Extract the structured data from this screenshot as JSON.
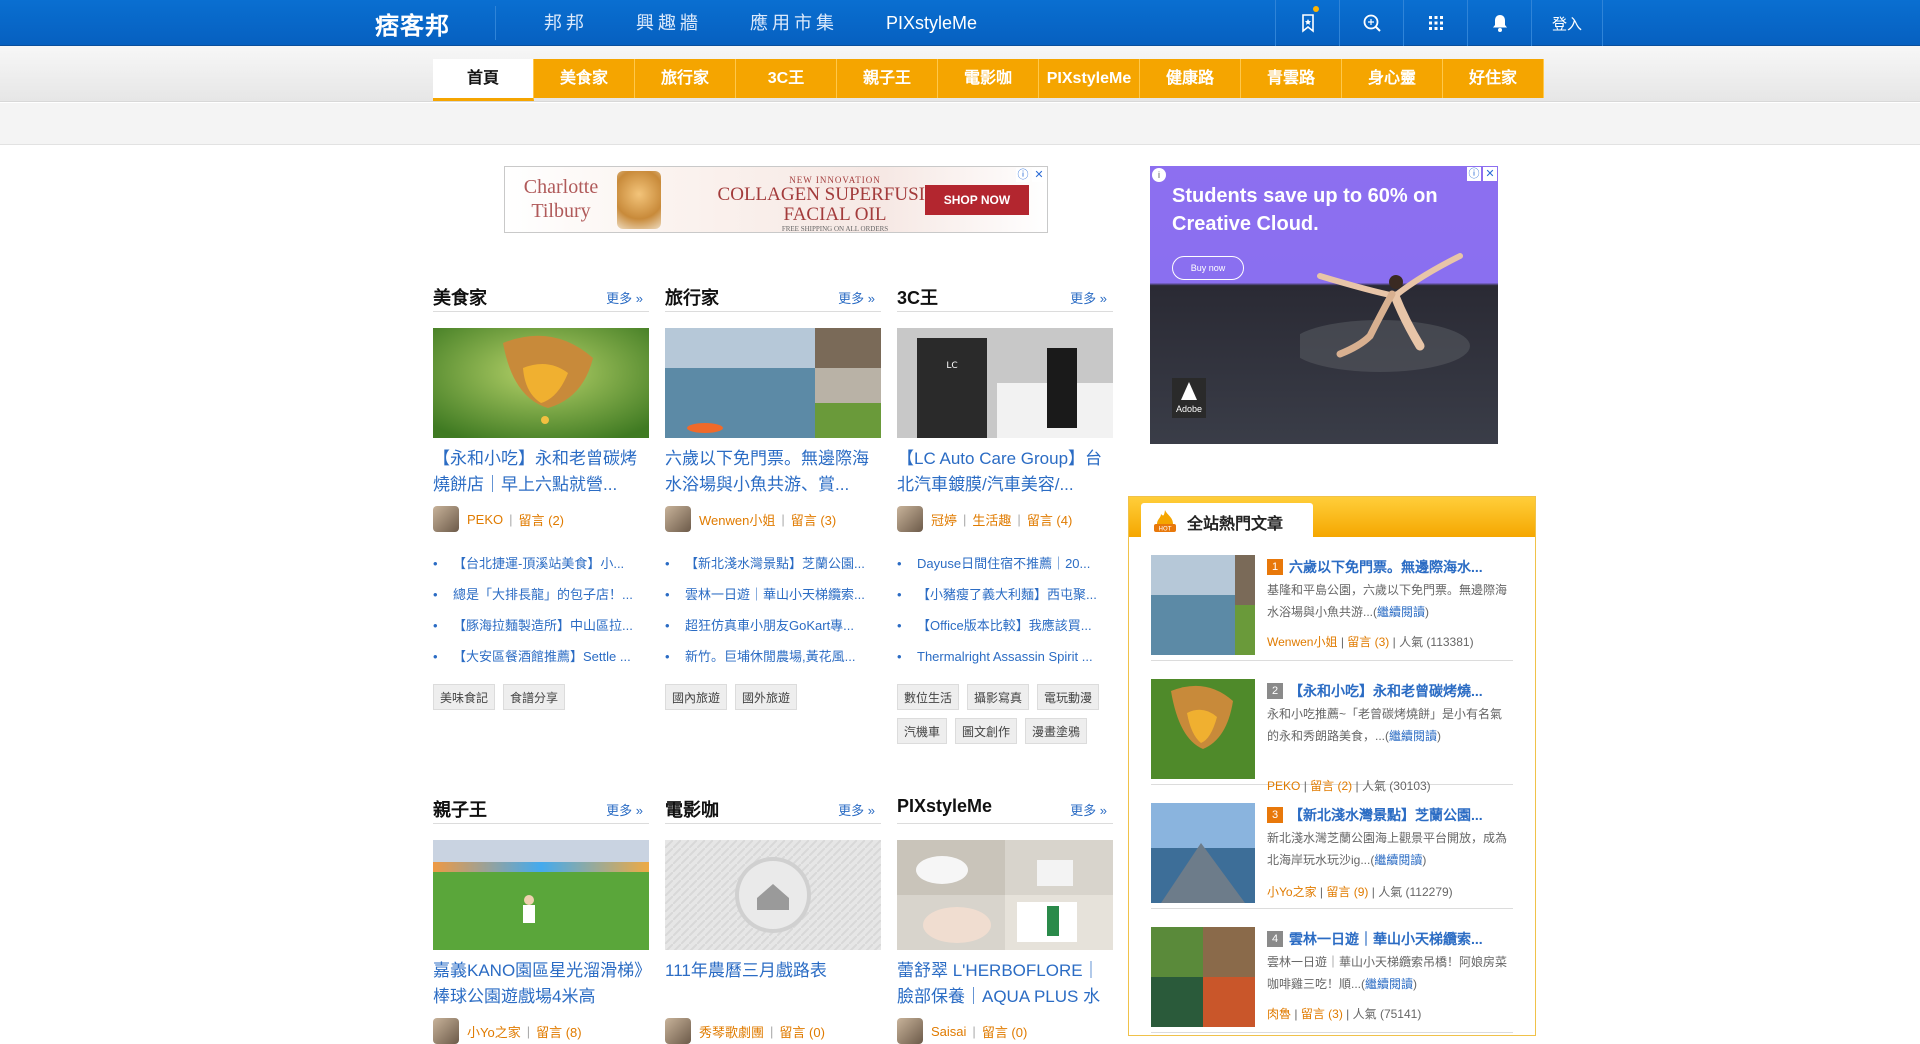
{
  "topbar": {
    "logo_text": "痞客邦",
    "nav": [
      "邦邦",
      "興趣牆",
      "應用市集",
      "PIXstyleMe"
    ],
    "login": "登入",
    "icons": [
      "bookmark-icon",
      "search-icon",
      "apps-grid-icon",
      "bell-icon"
    ]
  },
  "categories": {
    "tabs": [
      "首頁",
      "美食家",
      "旅行家",
      "3C王",
      "親子王",
      "電影咖",
      "PIXstyleMe",
      "健康路",
      "青雲路",
      "身心靈",
      "好住家"
    ],
    "active": "首頁",
    "active_color": "#f5a500"
  },
  "ads": {
    "top": {
      "brand": "Charlotte Tilbury",
      "line1": "NEW INNOVATION",
      "line2": "COLLAGEN SUPERFUSION",
      "line3": "FACIAL OIL",
      "line4": "FREE SHIPPING ON ALL ORDERS",
      "cta": "SHOP NOW"
    },
    "side": {
      "headline": "Students save up to 60% on Creative Cloud.",
      "cta": "Buy now",
      "brand": "Adobe"
    }
  },
  "more_label": "更多 »",
  "sections": [
    {
      "title": "美食家",
      "post_title": "【永和小吃】永和老曾碳烤燒餅店｜早上六點就營...",
      "author": "PEKO",
      "comments": "留言 (2)",
      "category": "",
      "list": [
        "【台北捷運-頂溪站美食】小...",
        "總是「大排長龍」的包子店！...",
        "【豚海拉麵製造所】中山區拉...",
        "【大安區餐酒館推薦】Settle ..."
      ],
      "tags": [
        "美味食記",
        "食譜分享"
      ]
    },
    {
      "title": "旅行家",
      "post_title": "六歲以下免門票。無邊際海水浴場與小魚共游、賞...",
      "author": "Wenwen小姐",
      "comments": "留言 (3)",
      "category": "",
      "list": [
        "【新北淺水灣景點】芝蘭公園...",
        "雲林一日遊｜華山小天梯纜索...",
        "超狂仿真車小朋友GoKart專...",
        "新竹。巨埔休閒農場,黃花風..."
      ],
      "tags": [
        "國內旅遊",
        "國外旅遊"
      ]
    },
    {
      "title": "3C王",
      "post_title": "【LC Auto Care Group】台北汽車鍍膜/汽車美容/...",
      "author": "冠婷",
      "comments": "留言 (4)",
      "category": "生活趣",
      "list": [
        "Dayuse日間住宿不推薦｜20...",
        "【小豬瘦了義大利麵】西屯聚...",
        "【Office版本比較】我應該買...",
        "Thermalright Assassin Spirit ..."
      ],
      "tags": [
        "數位生活",
        "攝影寫真",
        "電玩動漫",
        "汽機車",
        "圖文創作",
        "漫畫塗鴉"
      ]
    },
    {
      "title": "親子王",
      "post_title": "嘉義KANO園區星光溜滑梯》棒球公園遊戲場4米高",
      "author": "小Yo之家",
      "comments": "留言 (8)",
      "category": "",
      "list": [],
      "tags": []
    },
    {
      "title": "電影咖",
      "post_title": "111年農曆三月戲路表",
      "author": "秀琴歌劇團",
      "comments": "留言 (0)",
      "category": "",
      "list": [],
      "tags": []
    },
    {
      "title": "PIXstyleMe",
      "post_title": "蕾舒翠 L'HERBOFLORE｜臉部保養｜AQUA PLUS 水",
      "author": "Saisai",
      "comments": "留言 (0)",
      "category": "",
      "list": [],
      "tags": []
    }
  ],
  "hot": {
    "title": "全站熱門文章",
    "continue_label": "繼續閱讀",
    "popularity_label": "人氣",
    "items": [
      {
        "rank": "1",
        "rank_color": "#e8780a",
        "title": "六歲以下免門票。無邊際海水...",
        "desc": "基隆和平島公園，六歲以下免門票。無邊際海水浴場與小魚共游...(",
        "author": "Wenwen小姐",
        "comments": "留言 (3)",
        "views": "人氣 (113381)"
      },
      {
        "rank": "2",
        "rank_color": "#8a8a8a",
        "title": "【永和小吃】永和老曾碳烤燒...",
        "desc": "永和小吃推薦~「老曾碳烤燒餅」是小有名氣的永和秀朗路美食，...(",
        "author": "PEKO",
        "comments": "留言 (2)",
        "views": "人氣 (30103)"
      },
      {
        "rank": "3",
        "rank_color": "#e8780a",
        "title": "【新北淺水灣景點】芝蘭公園...",
        "desc": "新北淺水灣芝蘭公園海上觀景平台開放，成為北海岸玩水玩沙ig...(",
        "author": "小Yo之家",
        "comments": "留言 (9)",
        "views": "人氣 (112279)"
      },
      {
        "rank": "4",
        "rank_color": "#8a8a8a",
        "title": "雲林一日遊｜華山小天梯纜索...",
        "desc": "雲林一日遊｜華山小天梯纜索吊橋！阿娘房菜咖啡雞三吃！順...(",
        "author": "肉魯",
        "comments": "留言 (3)",
        "views": "人氣 (75141)"
      }
    ]
  }
}
